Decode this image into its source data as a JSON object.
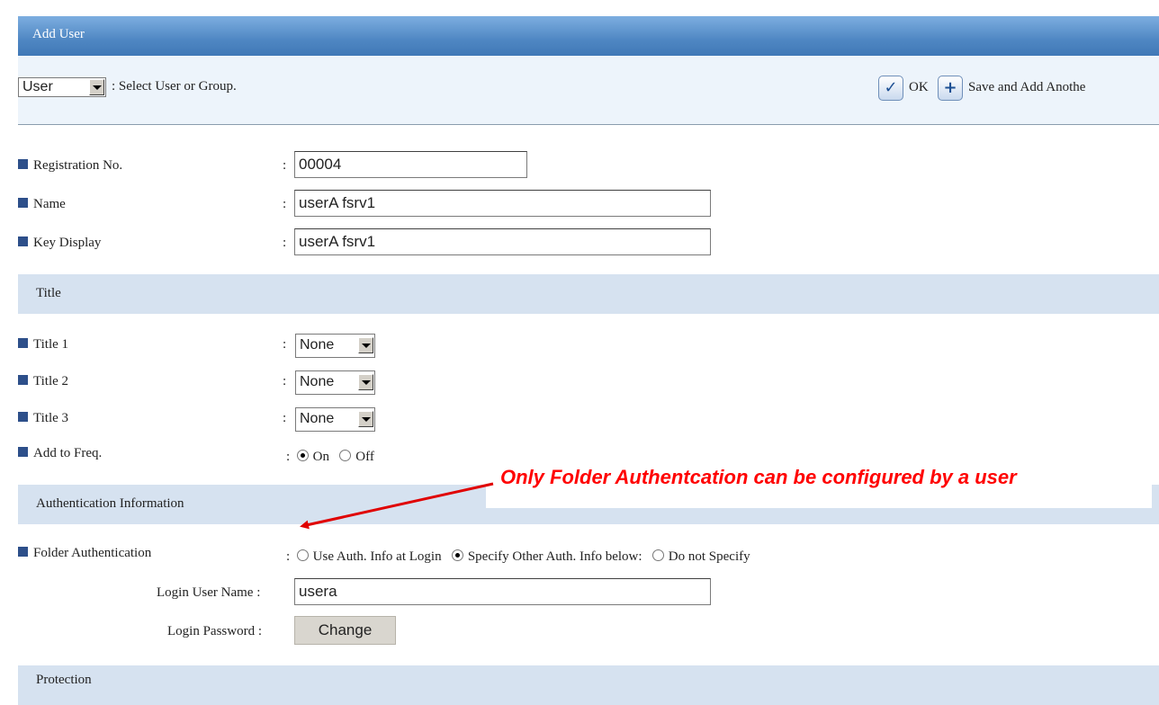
{
  "window": {
    "title": "Add User"
  },
  "toolbar": {
    "type_select": "User",
    "type_hint": ": Select User or Group.",
    "ok_label": "OK",
    "save_add_label": "Save and Add Anothe"
  },
  "fields": {
    "registration_no": {
      "label": "Registration No.",
      "value": "00004"
    },
    "name": {
      "label": "Name",
      "value": "userA fsrv1"
    },
    "key_display": {
      "label": "Key Display",
      "value": "userA fsrv1"
    }
  },
  "sections": {
    "title": "Title",
    "auth": "Authentication Information",
    "protection": "Protection"
  },
  "title_fields": [
    {
      "label": "Title 1",
      "value": "None"
    },
    {
      "label": "Title 2",
      "value": "None"
    },
    {
      "label": "Title 3",
      "value": "None"
    }
  ],
  "add_to_freq": {
    "label": "Add to Freq.",
    "on_label": "On",
    "off_label": "Off",
    "selected": "On"
  },
  "folder_auth": {
    "label": "Folder Authentication",
    "options": [
      "Use Auth. Info at Login",
      "Specify Other Auth. Info below:",
      "Do not Specify"
    ],
    "selected": "Specify Other Auth. Info below:",
    "login_user_label": "Login User Name :",
    "login_user_value": "usera",
    "login_password_label": "Login Password :",
    "change_label": "Change"
  },
  "annotation": {
    "text": "Only Folder Authentcation can be configured by a user",
    "color": "#ff0000"
  },
  "colors": {
    "title_bar": "#4f87c3",
    "section_bg": "#d6e2f0",
    "toolbar_bg": "#edf4fb",
    "bullet": "#2d4f8a"
  }
}
